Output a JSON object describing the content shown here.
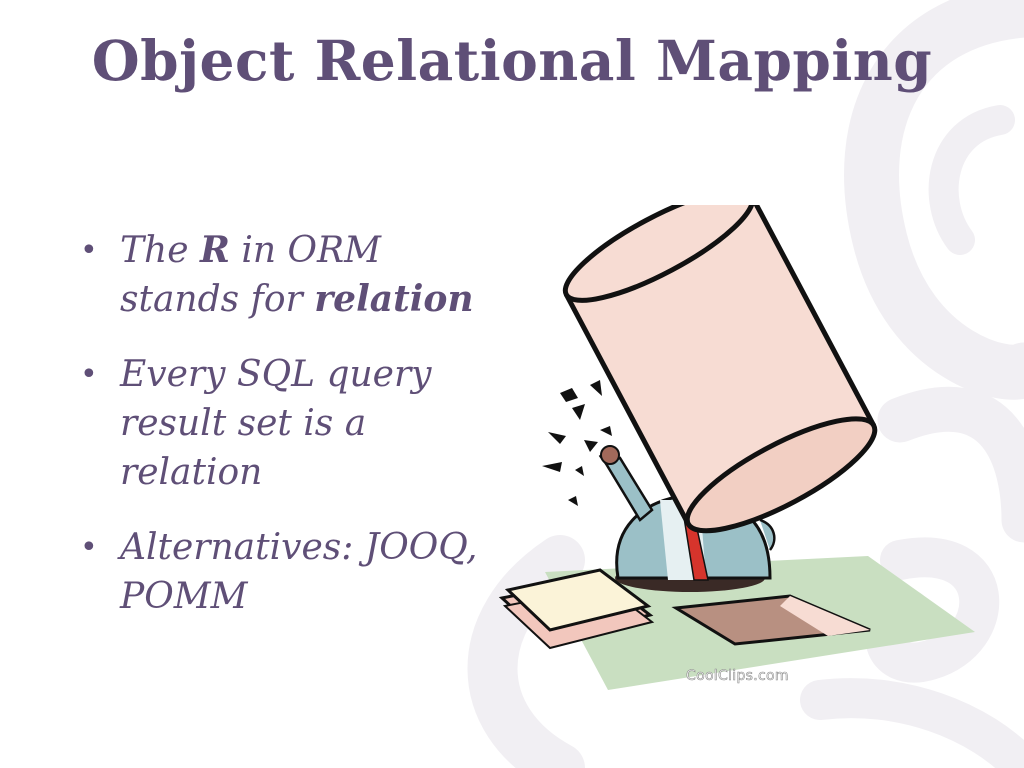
{
  "slide": {
    "title": "Object Relational Mapping",
    "bullets": [
      {
        "parts": [
          "The ",
          "R",
          " in ORM stands for ",
          "relation"
        ]
      },
      {
        "text": "Every SQL query result set is a relation"
      },
      {
        "text": "Alternatives: JOOQ, POMM"
      }
    ],
    "bullet_glyph": "•",
    "illustration": {
      "icon": "database-crushing-worker-illustration",
      "credit": "CoolClips.com"
    },
    "colors": {
      "text": "#5f4f77",
      "background": "#ffffff",
      "swirl": "#f1eff3",
      "cylinder": "#f7dcd3",
      "floor": "#c9dfc1",
      "shirt": "#9bc0c7",
      "tie": "#d6342c",
      "paper": "#fbf3d8"
    }
  }
}
